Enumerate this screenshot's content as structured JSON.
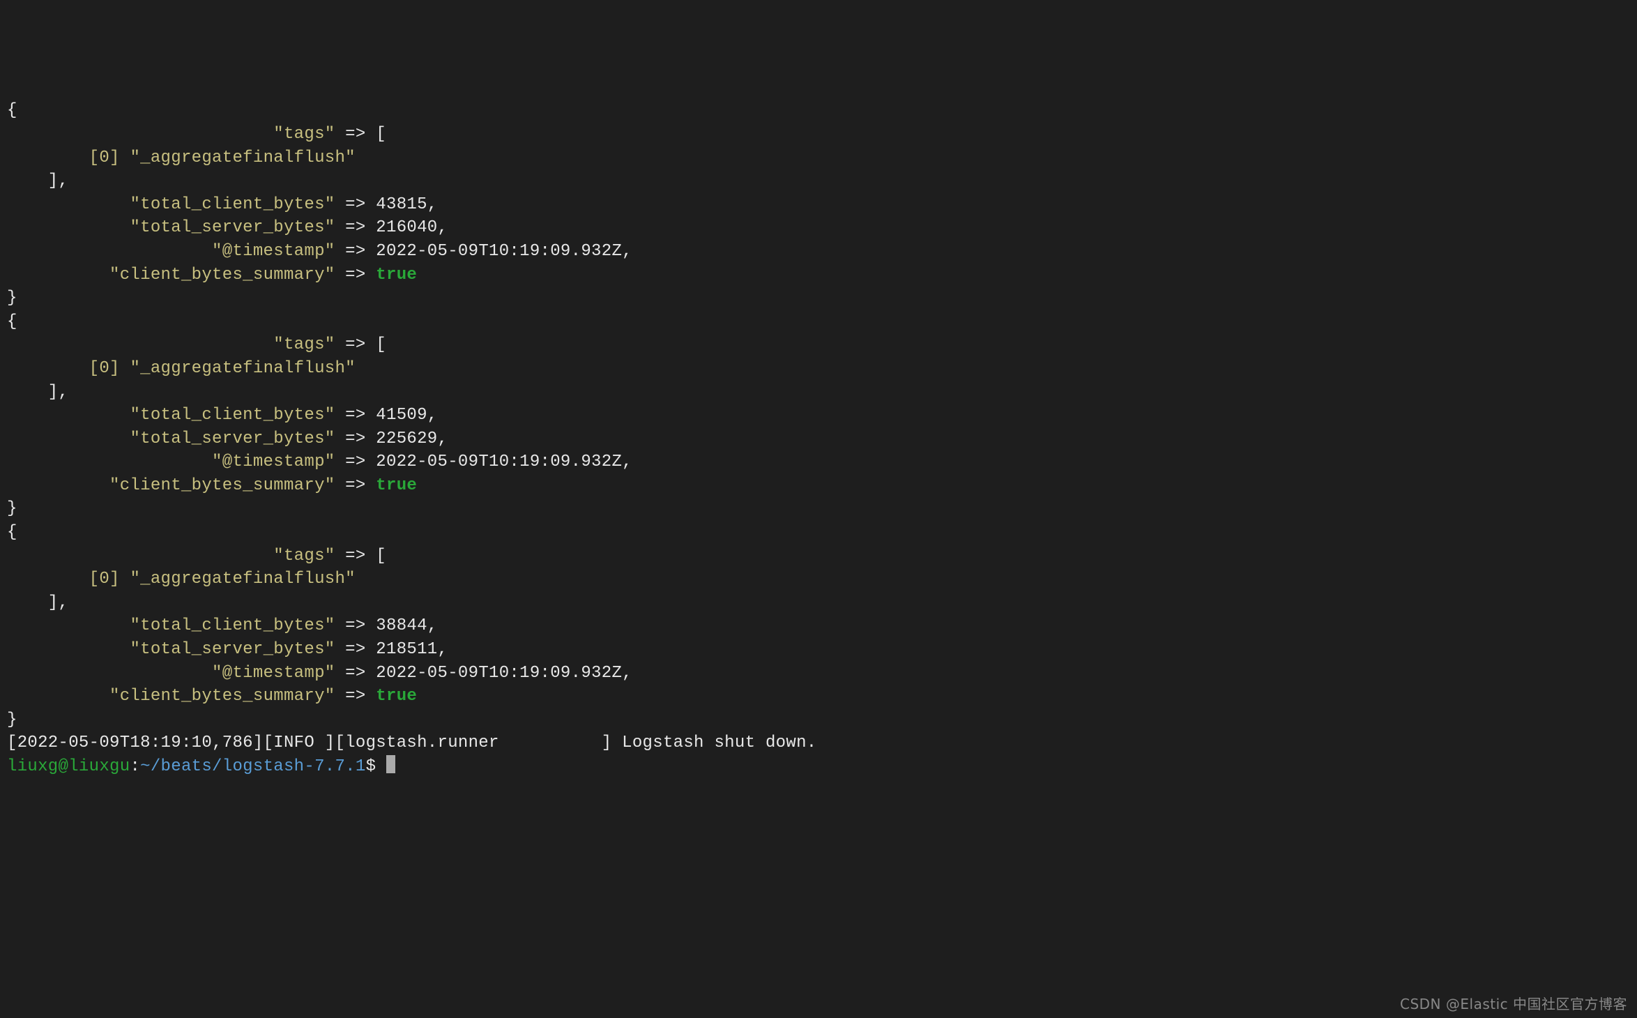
{
  "records": [
    {
      "tags": [
        "_aggregatefinalflush"
      ],
      "total_client_bytes": 43815,
      "total_server_bytes": 216040,
      "@timestamp": "2022-05-09T10:19:09.932Z",
      "client_bytes_summary": true
    },
    {
      "tags": [
        "_aggregatefinalflush"
      ],
      "total_client_bytes": 41509,
      "total_server_bytes": 225629,
      "@timestamp": "2022-05-09T10:19:09.932Z",
      "client_bytes_summary": true
    },
    {
      "tags": [
        "_aggregatefinalflush"
      ],
      "total_client_bytes": 38844,
      "total_server_bytes": 218511,
      "@timestamp": "2022-05-09T10:19:09.932Z",
      "client_bytes_summary": true
    }
  ],
  "arrow_column": 32,
  "tag_indent": 8,
  "body_indent": 4,
  "log_line": {
    "timestamp": "2022-05-09T18:19:10,786",
    "level": "INFO ",
    "module": "logstash.runner",
    "module_width": 25,
    "message": "Logstash shut down."
  },
  "prompt": {
    "user": "liuxg",
    "host": "liuxgu",
    "cwd": "~/beats/logstash-7.7.1",
    "symbol": "$"
  },
  "watermark": "CSDN @Elastic 中国社区官方博客"
}
